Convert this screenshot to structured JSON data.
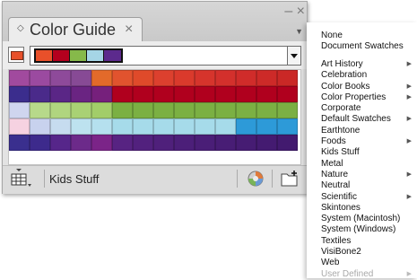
{
  "panel": {
    "tab_title": "Color Guide",
    "tab_arrows": "◇",
    "tab_close": "×",
    "win_controls": "– ×",
    "menu_button": "▼",
    "active_color": "#e8502a",
    "harmony_colors": [
      "#e8502a",
      "#b3001e",
      "#86b94a",
      "#a5d5e6",
      "#5c2a8d"
    ],
    "swatch_rows": [
      [
        "#a14a9e",
        "#9b4aa0",
        "#8e4a9a",
        "#874a95",
        "#e36a2a",
        "#e1532e",
        "#df4a2a",
        "#dc402e",
        "#da3a2c",
        "#d6342c",
        "#d3302c",
        "#d02c2a",
        "#cd2a28",
        "#ca2826"
      ],
      [
        "#3b2d8d",
        "#4a2a8a",
        "#5a2686",
        "#6a2482",
        "#76207c",
        "#b0001e",
        "#b0001e",
        "#b0001e",
        "#b0001e",
        "#b0001e",
        "#b0001e",
        "#b0001e",
        "#b0001e",
        "#b0001e"
      ],
      [
        "#cfd5ef",
        "#b7d98a",
        "#b0d57f",
        "#a9d174",
        "#a2cd69",
        "#7bb043",
        "#7bb043",
        "#7bb043",
        "#7bb043",
        "#7bb043",
        "#7bb043",
        "#7bb043",
        "#7bb043",
        "#7bb043"
      ],
      [
        "#f6d2e1",
        "#c8d2ee",
        "#c6dcef",
        "#bde2ef",
        "#b5e0ee",
        "#a6dbea",
        "#a6dbea",
        "#a6dbea",
        "#a6dbea",
        "#a6dbea",
        "#a6dbea",
        "#2d9ad8",
        "#2d9ad8",
        "#2d9ad8"
      ],
      [
        "#3a2f8e",
        "#3d2a8c",
        "#56268a",
        "#6c2a8a",
        "#7b2488",
        "#572382",
        "#52217e",
        "#4f207b",
        "#4c1f79",
        "#4a1e77",
        "#481d75",
        "#461c73",
        "#441b71",
        "#421a6f"
      ]
    ],
    "bottom_label": "Kids Stuff"
  },
  "menu": {
    "group1": [
      {
        "label": "None",
        "submenu": false,
        "disabled": false
      },
      {
        "label": "Document Swatches",
        "submenu": false,
        "disabled": false
      }
    ],
    "group2": [
      {
        "label": "Art History",
        "submenu": true,
        "disabled": false
      },
      {
        "label": "Celebration",
        "submenu": false,
        "disabled": false
      },
      {
        "label": "Color Books",
        "submenu": true,
        "disabled": false
      },
      {
        "label": "Color Properties",
        "submenu": true,
        "disabled": false
      },
      {
        "label": "Corporate",
        "submenu": false,
        "disabled": false
      },
      {
        "label": "Default Swatches",
        "submenu": true,
        "disabled": false
      },
      {
        "label": "Earthtone",
        "submenu": false,
        "disabled": false
      },
      {
        "label": "Foods",
        "submenu": true,
        "disabled": false
      },
      {
        "label": "Kids Stuff",
        "submenu": false,
        "disabled": false
      },
      {
        "label": "Metal",
        "submenu": false,
        "disabled": false
      },
      {
        "label": "Nature",
        "submenu": true,
        "disabled": false
      },
      {
        "label": "Neutral",
        "submenu": false,
        "disabled": false
      },
      {
        "label": "Scientific",
        "submenu": true,
        "disabled": false
      },
      {
        "label": "Skintones",
        "submenu": false,
        "disabled": false
      },
      {
        "label": "System (Macintosh)",
        "submenu": false,
        "disabled": false
      },
      {
        "label": "System (Windows)",
        "submenu": false,
        "disabled": false
      },
      {
        "label": "Textiles",
        "submenu": false,
        "disabled": false
      },
      {
        "label": "VisiBone2",
        "submenu": false,
        "disabled": false
      },
      {
        "label": "Web",
        "submenu": false,
        "disabled": false
      },
      {
        "label": "User Defined",
        "submenu": true,
        "disabled": true
      }
    ],
    "submenu_arrow": "▶"
  }
}
